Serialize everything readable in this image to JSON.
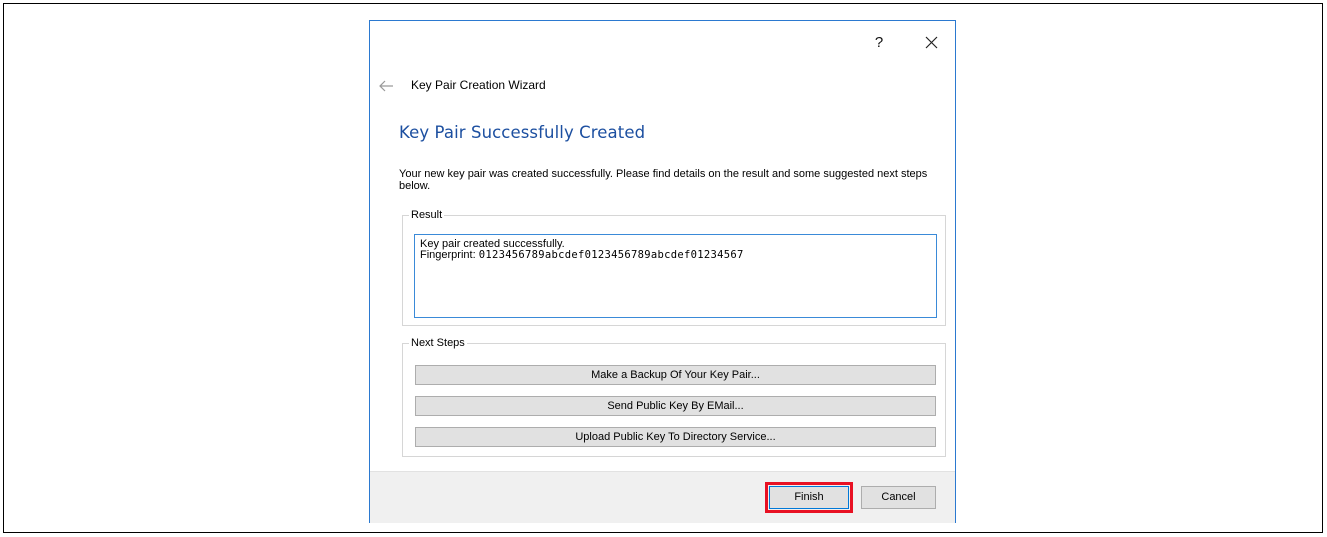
{
  "titlebar": {
    "help_label": "?",
    "close_label": "close-icon"
  },
  "wizard": {
    "title": "Key Pair Creation Wizard",
    "back_icon": "arrow-left-icon"
  },
  "page": {
    "title": "Key Pair Successfully Created",
    "description": "Your new key pair was created successfully. Please find details on the result and some suggested next steps below."
  },
  "result": {
    "group_label": "Result",
    "line1": "Key pair created successfully.",
    "fingerprint_label": "Fingerprint:",
    "fingerprint_value": "0123456789abcdef0123456789abcdef01234567"
  },
  "next_steps": {
    "group_label": "Next Steps",
    "buttons": [
      "Make a Backup Of Your Key Pair...",
      "Send Public Key By EMail...",
      "Upload Public Key To Directory Service..."
    ]
  },
  "footer": {
    "finish_label": "Finish",
    "cancel_label": "Cancel"
  },
  "colors": {
    "accent_border": "#2b79d0",
    "title_blue": "#1c4fa0",
    "highlight_red": "#e81123"
  }
}
